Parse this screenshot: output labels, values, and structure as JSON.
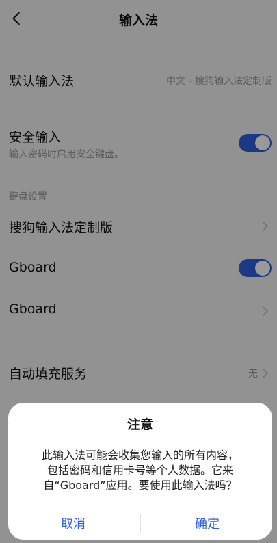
{
  "header": {
    "title": "输入法",
    "back_icon": "back-chevron-icon"
  },
  "rows": {
    "default_im": {
      "label": "默认输入法",
      "value": "中文 - 搜狗输入法定制版"
    },
    "secure_input": {
      "label": "安全输入",
      "description": "输入密码时启用安全键盘。",
      "enabled": true
    },
    "keyboard_section": {
      "title": "键盘设置"
    },
    "sogou": {
      "label": "搜狗输入法定制版"
    },
    "gboard_toggle": {
      "label": "Gboard",
      "enabled": true
    },
    "gboard_link": {
      "label": "Gboard"
    },
    "autofill": {
      "label": "自动填充服务",
      "value": "无"
    }
  },
  "dialog": {
    "title": "注意",
    "message_line1": "此输入法可能会收集您输入的所有内容，",
    "message_line2": "包括密码和信用卡号等个人数据。它来",
    "message_line3": "自“Gboard”应用。要使用此输入法吗？",
    "cancel": "取消",
    "confirm": "确定"
  },
  "colors": {
    "accent": "#2f5fe0",
    "background": "#f4f4f4",
    "secondary_text": "#999999"
  }
}
